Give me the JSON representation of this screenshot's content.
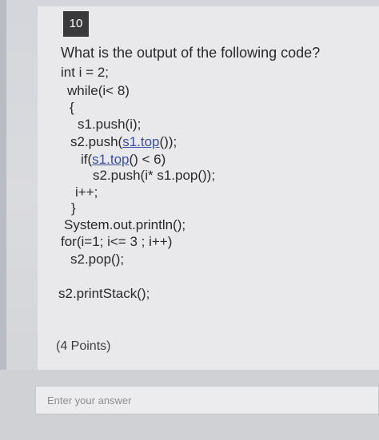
{
  "question": {
    "number": "10",
    "prompt": "What is the output of the following code?",
    "points": "(4 Points)"
  },
  "code": {
    "line1": "int i = 2;",
    "line2": "while(i< 8)",
    "line3": "{",
    "line4": "s1.push(i);",
    "line5_pre": "s2.push(",
    "line5_link": "s1.top",
    "line5_post": "());",
    "line6_pre": "if(",
    "line6_link": "s1.top",
    "line6_post": "() < 6)",
    "line7": "s2.push(i* s1.pop());",
    "line8": "i++;",
    "line9": "}",
    "line10": "System.out.println();",
    "line11": "for(i=1; i<= 3 ; i++)",
    "line12": "s2.pop();",
    "line13": "s2.printStack();"
  },
  "answer": {
    "placeholder": "Enter your answer"
  }
}
